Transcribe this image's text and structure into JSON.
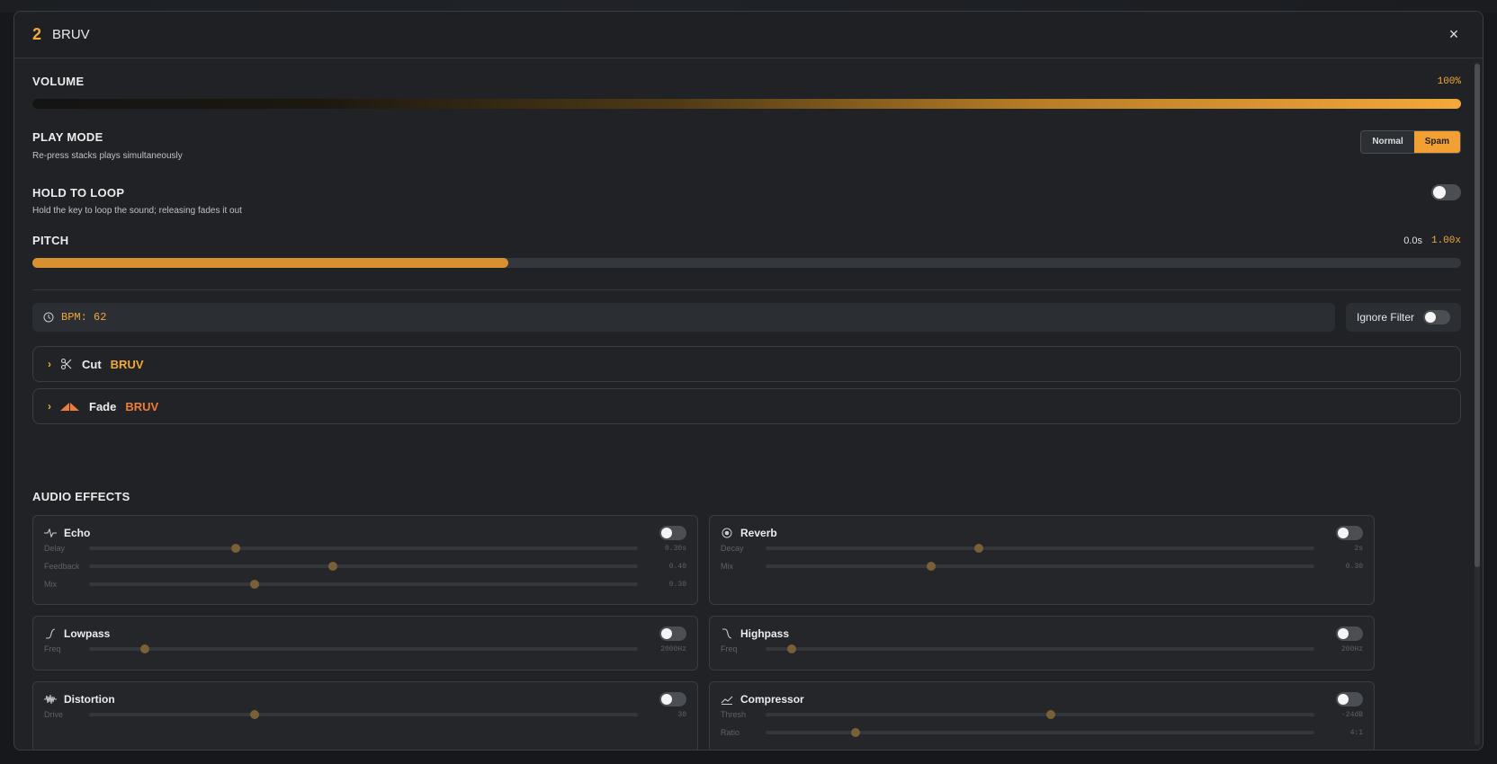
{
  "header": {
    "slot_number": "2",
    "sound_name": "BRUV",
    "close_label": "×"
  },
  "volume": {
    "label": "VOLUME",
    "value_text": "100%",
    "level": 1.0
  },
  "play_mode": {
    "label": "PLAY MODE",
    "description": "Re-press stacks plays simultaneously",
    "options": [
      "Normal",
      "Spam"
    ],
    "selected": "Spam"
  },
  "hold_to_loop": {
    "label": "HOLD TO LOOP",
    "description": "Hold the key to loop the sound; releasing fades it out",
    "enabled": false
  },
  "pitch": {
    "label": "PITCH",
    "time_text": "0.0s",
    "value_text": "1.00x",
    "level": 0.333
  },
  "bpm": {
    "text": "BPM: 62"
  },
  "ignore_filter": {
    "label": "Ignore Filter",
    "enabled": false
  },
  "cut": {
    "title": "Cut",
    "accent": "BRUV",
    "accent_color": "#f2a93b"
  },
  "fade": {
    "title": "Fade",
    "accent": "BRUV",
    "accent_color": "#ef7d3a"
  },
  "audio_effects": {
    "title": "AUDIO EFFECTS",
    "echo": {
      "name": "Echo",
      "icon": "pulse-icon",
      "enabled": false,
      "params": [
        {
          "label": "Delay",
          "value": "0.30s",
          "level": 0.267
        },
        {
          "label": "Feedback",
          "value": "0.40",
          "level": 0.445
        },
        {
          "label": "Mix",
          "value": "0.30",
          "level": 0.302
        }
      ]
    },
    "reverb": {
      "name": "Reverb",
      "icon": "radio-icon",
      "enabled": false,
      "params": [
        {
          "label": "Decay",
          "value": "2s",
          "level": 0.389
        },
        {
          "label": "Mix",
          "value": "0.30",
          "level": 0.302
        }
      ]
    },
    "lowpass": {
      "name": "Lowpass",
      "icon": "lowpass-icon",
      "enabled": false,
      "params": [
        {
          "label": "Freq",
          "value": "2000Hz",
          "level": 0.101
        }
      ]
    },
    "highpass": {
      "name": "Highpass",
      "icon": "highpass-icon",
      "enabled": false,
      "params": [
        {
          "label": "Freq",
          "value": "200Hz",
          "level": 0.048
        }
      ]
    },
    "distortion": {
      "name": "Distortion",
      "icon": "waveform-icon",
      "enabled": false,
      "params": [
        {
          "label": "Drive",
          "value": "30",
          "level": 0.302
        }
      ]
    },
    "compressor": {
      "name": "Compressor",
      "icon": "compressor-icon",
      "enabled": false,
      "params": [
        {
          "label": "Thresh",
          "value": "-24dB",
          "level": 0.52
        },
        {
          "label": "Ratio",
          "value": "4:1",
          "level": 0.164
        }
      ]
    }
  }
}
